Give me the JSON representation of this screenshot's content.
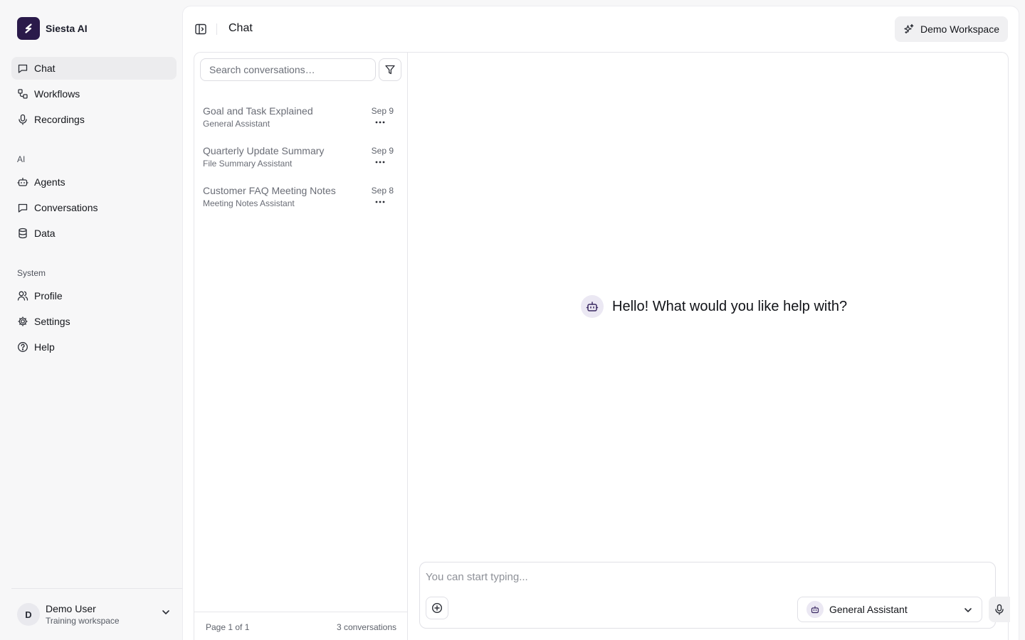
{
  "brand": {
    "name": "Siesta AI",
    "logo_letter": "S",
    "color": "#2a1a4a"
  },
  "nav": {
    "main": [
      {
        "label": "Chat",
        "icon": "chat-bubble-icon",
        "active": true
      },
      {
        "label": "Workflows",
        "icon": "workflow-icon",
        "active": false
      },
      {
        "label": "Recordings",
        "icon": "microphone-icon",
        "active": false
      }
    ],
    "ai_label": "AI",
    "ai": [
      {
        "label": "Agents",
        "icon": "bot-icon"
      },
      {
        "label": "Conversations",
        "icon": "chat-bubble-icon"
      },
      {
        "label": "Data",
        "icon": "database-icon"
      }
    ],
    "system_label": "System",
    "system": [
      {
        "label": "Profile",
        "icon": "users-icon"
      },
      {
        "label": "Settings",
        "icon": "gear-icon"
      },
      {
        "label": "Help",
        "icon": "help-circle-icon"
      }
    ]
  },
  "user": {
    "initial": "D",
    "name": "Demo User",
    "workspace": "Training workspace"
  },
  "header": {
    "title": "Chat",
    "workspace_button": "Demo Workspace"
  },
  "conversations": {
    "search_placeholder": "Search conversations…",
    "items": [
      {
        "title": "Goal and Task Explained",
        "agent": "General Assistant",
        "date": "Sep 9"
      },
      {
        "title": "Quarterly Update Summary",
        "agent": "File Summary Assistant",
        "date": "Sep 9"
      },
      {
        "title": "Customer FAQ Meeting Notes",
        "agent": "Meeting Notes Assistant",
        "date": "Sep 8"
      }
    ],
    "page_label": "Page 1 of 1",
    "count_label": "3 conversations"
  },
  "chat": {
    "greeting": "Hello! What would you like help with?",
    "input_placeholder": "You can start typing...",
    "selected_agent": "General Assistant"
  }
}
